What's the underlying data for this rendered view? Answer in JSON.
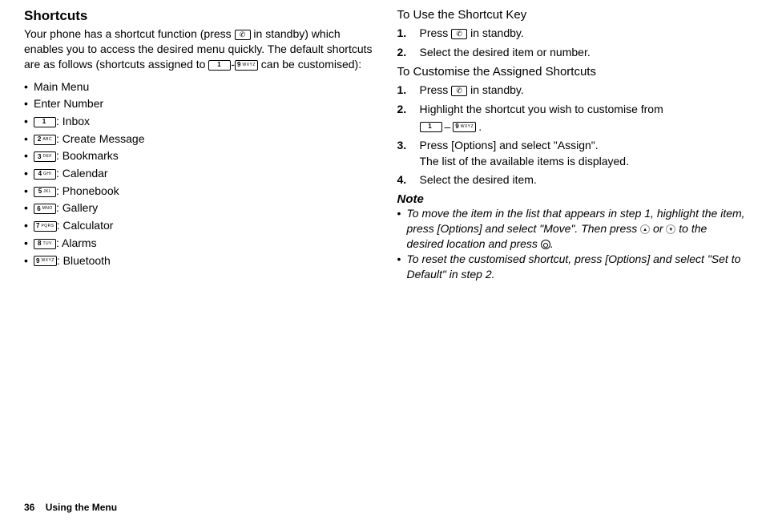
{
  "left": {
    "title": "Shortcuts",
    "intro_part1": "Your phone has a shortcut function (press ",
    "intro_part2": " in standby) which enables you to access the desired menu quickly. The default shortcuts are as follows (shortcuts assigned to ",
    "intro_part3": "-",
    "intro_part4": " can be customised):",
    "items": [
      {
        "key": null,
        "label": "Main Menu"
      },
      {
        "key": null,
        "label": "Enter Number"
      },
      {
        "key": {
          "num": "1",
          "txt": ""
        },
        "label": ": Inbox"
      },
      {
        "key": {
          "num": "2",
          "txt": "ABC"
        },
        "label": ": Create Message"
      },
      {
        "key": {
          "num": "3",
          "txt": "DEF"
        },
        "label": ": Bookmarks"
      },
      {
        "key": {
          "num": "4",
          "txt": "GHI"
        },
        "label": ": Calendar"
      },
      {
        "key": {
          "num": "5",
          "txt": "JKL"
        },
        "label": ": Phonebook"
      },
      {
        "key": {
          "num": "6",
          "txt": "MNO"
        },
        "label": ": Gallery"
      },
      {
        "key": {
          "num": "7",
          "txt": "PQRS"
        },
        "label": ": Calculator"
      },
      {
        "key": {
          "num": "8",
          "txt": "TUV"
        },
        "label": ": Alarms"
      },
      {
        "key": {
          "num": "9",
          "txt": "WXYZ"
        },
        "label": ": Bluetooth"
      }
    ]
  },
  "right": {
    "section1": {
      "heading": "To Use the Shortcut Key",
      "steps": [
        {
          "pre": "Press ",
          "post": " in standby.",
          "icon": "action"
        },
        {
          "text": "Select the desired item or number."
        }
      ]
    },
    "section2": {
      "heading": "To Customise the Assigned Shortcuts",
      "steps": [
        {
          "pre": "Press ",
          "post": " in standby.",
          "icon": "action"
        },
        {
          "text_top": "Highlight the shortcut you wish to customise from ",
          "range_sep": "–",
          "range_end": "."
        },
        {
          "text": "Press [Options] and select \"Assign\".",
          "sub": "The list of the available items is displayed."
        },
        {
          "text": "Select the desired item."
        }
      ]
    },
    "note_label": "Note",
    "notes": [
      "To move the item in the list that appears in step 1, highlight the item, press [Options] and select \"Move\". Then press ⬆ or ⬇ to the desired location and press ⭕.",
      "To reset the customised shortcut, press [Options] and select \"Set to Default\" in step 2."
    ],
    "note1_p1": "To move the item in the list that appears in step 1, highlight the item, press [Options] and select \"Move\". Then press ",
    "note1_p2": " or ",
    "note1_p3": " to the desired location and press ",
    "note1_p4": ".",
    "note2": "To reset the customised shortcut, press [Options] and select \"Set to Default\" in step 2."
  },
  "footer": {
    "page": "36",
    "title": "Using the Menu"
  },
  "keys": {
    "k1": {
      "num": "1",
      "txt": ""
    },
    "k9": {
      "num": "9",
      "txt": "WXYZ"
    }
  }
}
